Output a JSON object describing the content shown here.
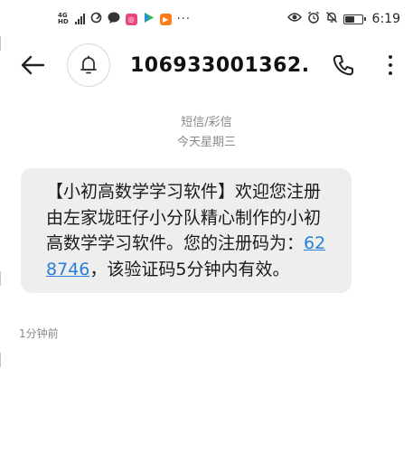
{
  "status_bar": {
    "signal_label_top": "4G",
    "signal_label_bottom": "HD",
    "dots": "···",
    "battery_level": 0.6,
    "time": "6:19"
  },
  "header": {
    "contact_name": "10693300136​2...",
    "icons": [
      "back-arrow-icon",
      "bell-icon",
      "phone-icon",
      "more-vertical-icon"
    ]
  },
  "conversation": {
    "message_type": "短信/彩信",
    "date_label": "今天星期三",
    "message": {
      "text_before_code": "【小初高数学学习软件】欢迎您注册由左家垅旺仔小分队精心制作的小初高数学学习软件。您的注册码为：",
      "code": "628746",
      "text_after_code": "，该验证码5分钟内有效。",
      "time": "1分钟前"
    }
  },
  "colors": {
    "bubble_bg": "#eeeeee",
    "link": "#2b7fd6",
    "meta_text": "#8a8a8a"
  }
}
